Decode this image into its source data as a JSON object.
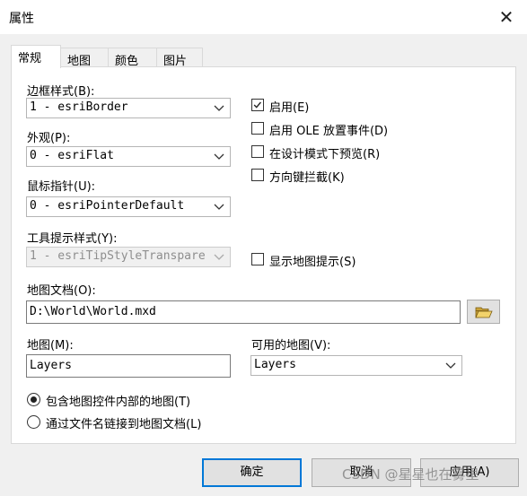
{
  "window": {
    "title": "属性",
    "close_glyph": "✕"
  },
  "tabs": [
    {
      "label": "常规",
      "active": true
    },
    {
      "label": "地图",
      "active": false
    },
    {
      "label": "颜色",
      "active": false
    },
    {
      "label": "图片",
      "active": false
    }
  ],
  "general": {
    "border_style": {
      "label": "边框样式(B):",
      "value": "1 - esriBorder"
    },
    "appearance": {
      "label": "外观(P):",
      "value": "0 - esriFlat"
    },
    "mouse_pointer": {
      "label": "鼠标指针(U):",
      "value": "0 - esriPointerDefault"
    },
    "tooltip_style": {
      "label": "工具提示样式(Y):",
      "value": "1 - esriTipStyleTranspare",
      "disabled": true
    },
    "checkboxes": [
      {
        "label": "启用(E)",
        "checked": true
      },
      {
        "label": "启用 OLE 放置事件(D)",
        "checked": false
      },
      {
        "label": "在设计模式下预览(R)",
        "checked": false
      },
      {
        "label": "方向键拦截(K)",
        "checked": false
      }
    ],
    "show_map_tips": {
      "label": "显示地图提示(S)",
      "checked": false
    },
    "map_document": {
      "label": "地图文档(O):",
      "value": "D:\\World\\World.mxd",
      "browse_icon": "folder-open-icon"
    },
    "map": {
      "label": "地图(M):",
      "value": "Layers"
    },
    "available_maps": {
      "label": "可用的地图(V):",
      "value": "Layers"
    },
    "radios": [
      {
        "label": "包含地图控件内部的地图(T)",
        "selected": true
      },
      {
        "label": "通过文件名链接到地图文档(L)",
        "selected": false
      }
    ]
  },
  "buttons": {
    "ok": "确定",
    "cancel": "取消",
    "apply": "应用(A)"
  },
  "watermark": "CSDN @星星也在雾里",
  "colors": {
    "accent": "#0078d7",
    "panel": "#ffffff",
    "window": "#f0f0f0"
  }
}
